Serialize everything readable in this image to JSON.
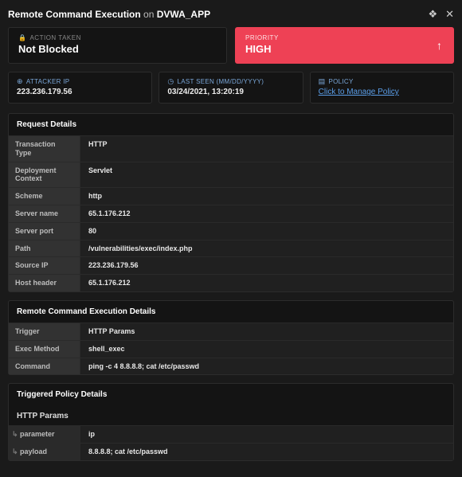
{
  "header": {
    "title_prefix": "Remote Command Execution",
    "title_on": "on",
    "app_name": "DVWA_APP"
  },
  "action": {
    "label": "ACTION TAKEN",
    "value": "Not Blocked"
  },
  "priority": {
    "label": "PRIORITY",
    "value": "HIGH"
  },
  "info": {
    "attacker_ip": {
      "label": "ATTACKER IP",
      "value": "223.236.179.56"
    },
    "last_seen": {
      "label": "LAST SEEN (MM/DD/YYYY)",
      "value": "03/24/2021, 13:20:19"
    },
    "policy": {
      "label": "POLICY",
      "link": "Click to Manage Policy"
    }
  },
  "sections": {
    "request_details": {
      "title": "Request Details",
      "rows": [
        {
          "k": "Transaction Type",
          "v": "HTTP"
        },
        {
          "k": "Deployment Context",
          "v": "Servlet"
        },
        {
          "k": "Scheme",
          "v": "http"
        },
        {
          "k": "Server name",
          "v": "65.1.176.212"
        },
        {
          "k": "Server port",
          "v": "80"
        },
        {
          "k": "Path",
          "v": "/vulnerabilities/exec/index.php"
        },
        {
          "k": "Source IP",
          "v": "223.236.179.56"
        },
        {
          "k": "Host header",
          "v": "65.1.176.212"
        }
      ]
    },
    "rce_details": {
      "title": "Remote Command Execution Details",
      "rows": [
        {
          "k": "Trigger",
          "v": "HTTP Params"
        },
        {
          "k": "Exec Method",
          "v": "shell_exec"
        },
        {
          "k": "Command",
          "v": "ping -c 4 8.8.8.8; cat /etc/passwd"
        }
      ]
    },
    "policy_details": {
      "title": "Triggered Policy Details",
      "subheader": "HTTP Params",
      "rows": [
        {
          "k": "parameter",
          "v": "ip"
        },
        {
          "k": "payload",
          "v": "8.8.8.8; cat /etc/passwd"
        }
      ]
    }
  }
}
